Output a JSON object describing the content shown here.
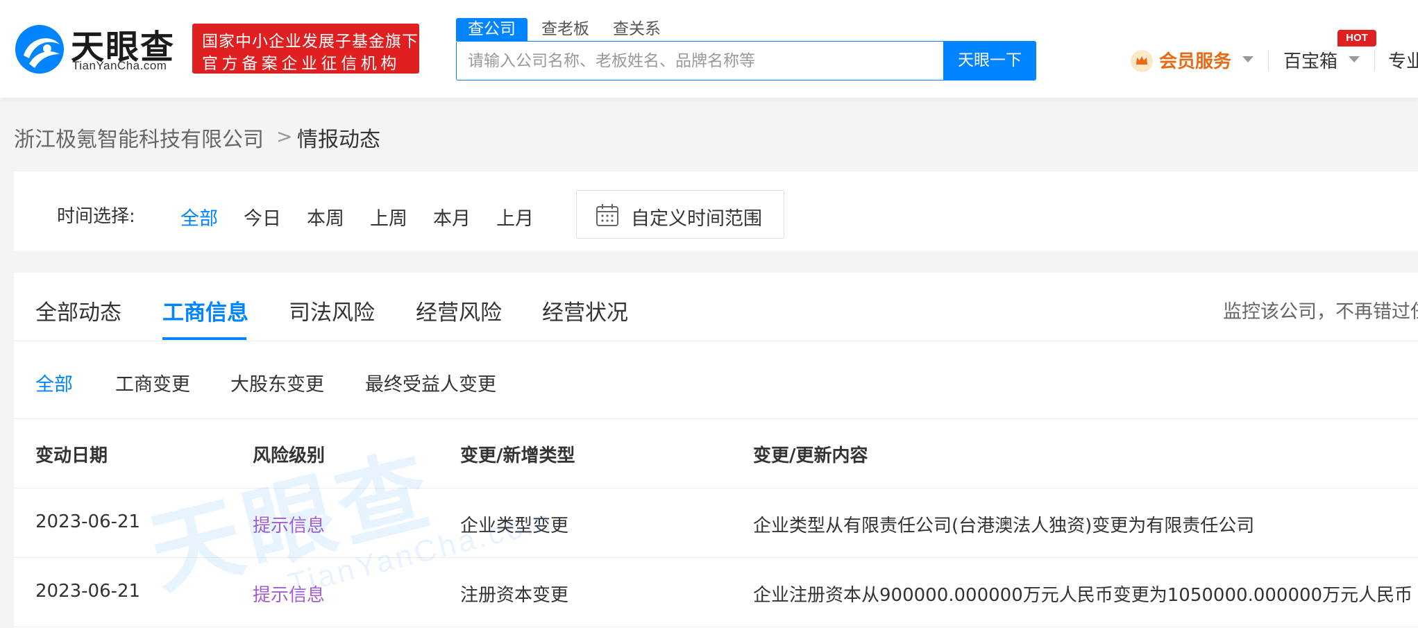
{
  "header": {
    "logo_cn": "天眼查",
    "logo_en": "TianYanCha.com",
    "badge_line1": "国家中小企业发展子基金旗下",
    "badge_line2": "官方备案企业征信机构",
    "search_tabs": [
      "查公司",
      "查老板",
      "查关系"
    ],
    "search_placeholder": "请输入公司名称、老板姓名、品牌名称等",
    "search_button": "天眼一下",
    "vip_label": "会员服务",
    "treasure_label": "百宝箱",
    "hot_badge": "HOT",
    "pro_label": "专业"
  },
  "breadcrumb": {
    "company": "浙江极氪智能科技有限公司",
    "separator": ">",
    "current": "情报动态"
  },
  "time_filter": {
    "label": "时间选择:",
    "options": [
      "全部",
      "今日",
      "本周",
      "上周",
      "本月",
      "上月"
    ],
    "active_index": 0,
    "custom_range": "自定义时间范围"
  },
  "main_tabs": {
    "items": [
      "全部动态",
      "工商信息",
      "司法风险",
      "经营风险",
      "经营状况"
    ],
    "active_index": 1,
    "monitor_text": "监控该公司，不再错过任"
  },
  "sub_tabs": {
    "items": [
      "全部",
      "工商变更",
      "大股东变更",
      "最终受益人变更"
    ],
    "active_index": 0
  },
  "table": {
    "headers": [
      "变动日期",
      "风险级别",
      "变更/新增类型",
      "变更/更新内容"
    ],
    "rows": [
      {
        "date": "2023-06-21",
        "risk": "提示信息",
        "type": "企业类型变更",
        "content": "企业类型从有限责任公司(台港澳法人独资)变更为有限责任公司"
      },
      {
        "date": "2023-06-21",
        "risk": "提示信息",
        "type": "注册资本变更",
        "content": "企业注册资本从900000.000000万元人民币变更为1050000.000000万元人民币"
      }
    ]
  },
  "watermark": {
    "cn": "天眼查",
    "en": "TianYanCha.com"
  },
  "colors": {
    "accent": "#0084ff",
    "brand_red": "#e02020",
    "vip_orange": "#e86a14",
    "risk_purple": "#a65bd6"
  }
}
